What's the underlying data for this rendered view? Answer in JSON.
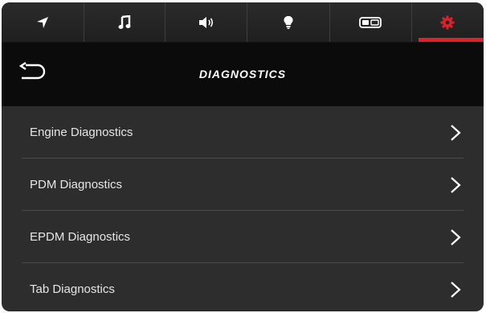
{
  "tabs": [
    {
      "icon": "navigation-arrow-icon",
      "active": false
    },
    {
      "icon": "music-note-icon",
      "active": false
    },
    {
      "icon": "speaker-volume-icon",
      "active": false
    },
    {
      "icon": "light-bulb-icon",
      "active": false
    },
    {
      "icon": "toggle-switch-icon",
      "active": false
    },
    {
      "icon": "gear-icon",
      "active": true
    }
  ],
  "colors": {
    "accent": "#d8232a",
    "background": "#2d2d2d",
    "header": "#0b0b0b",
    "text": "#e6e6e6"
  },
  "header": {
    "title": "DIAGNOSTICS",
    "back_icon": "back-arrow-icon"
  },
  "menu": [
    {
      "label": "Engine Diagnostics"
    },
    {
      "label": "PDM Diagnostics"
    },
    {
      "label": "EPDM Diagnostics"
    },
    {
      "label": "Tab Diagnostics"
    }
  ]
}
